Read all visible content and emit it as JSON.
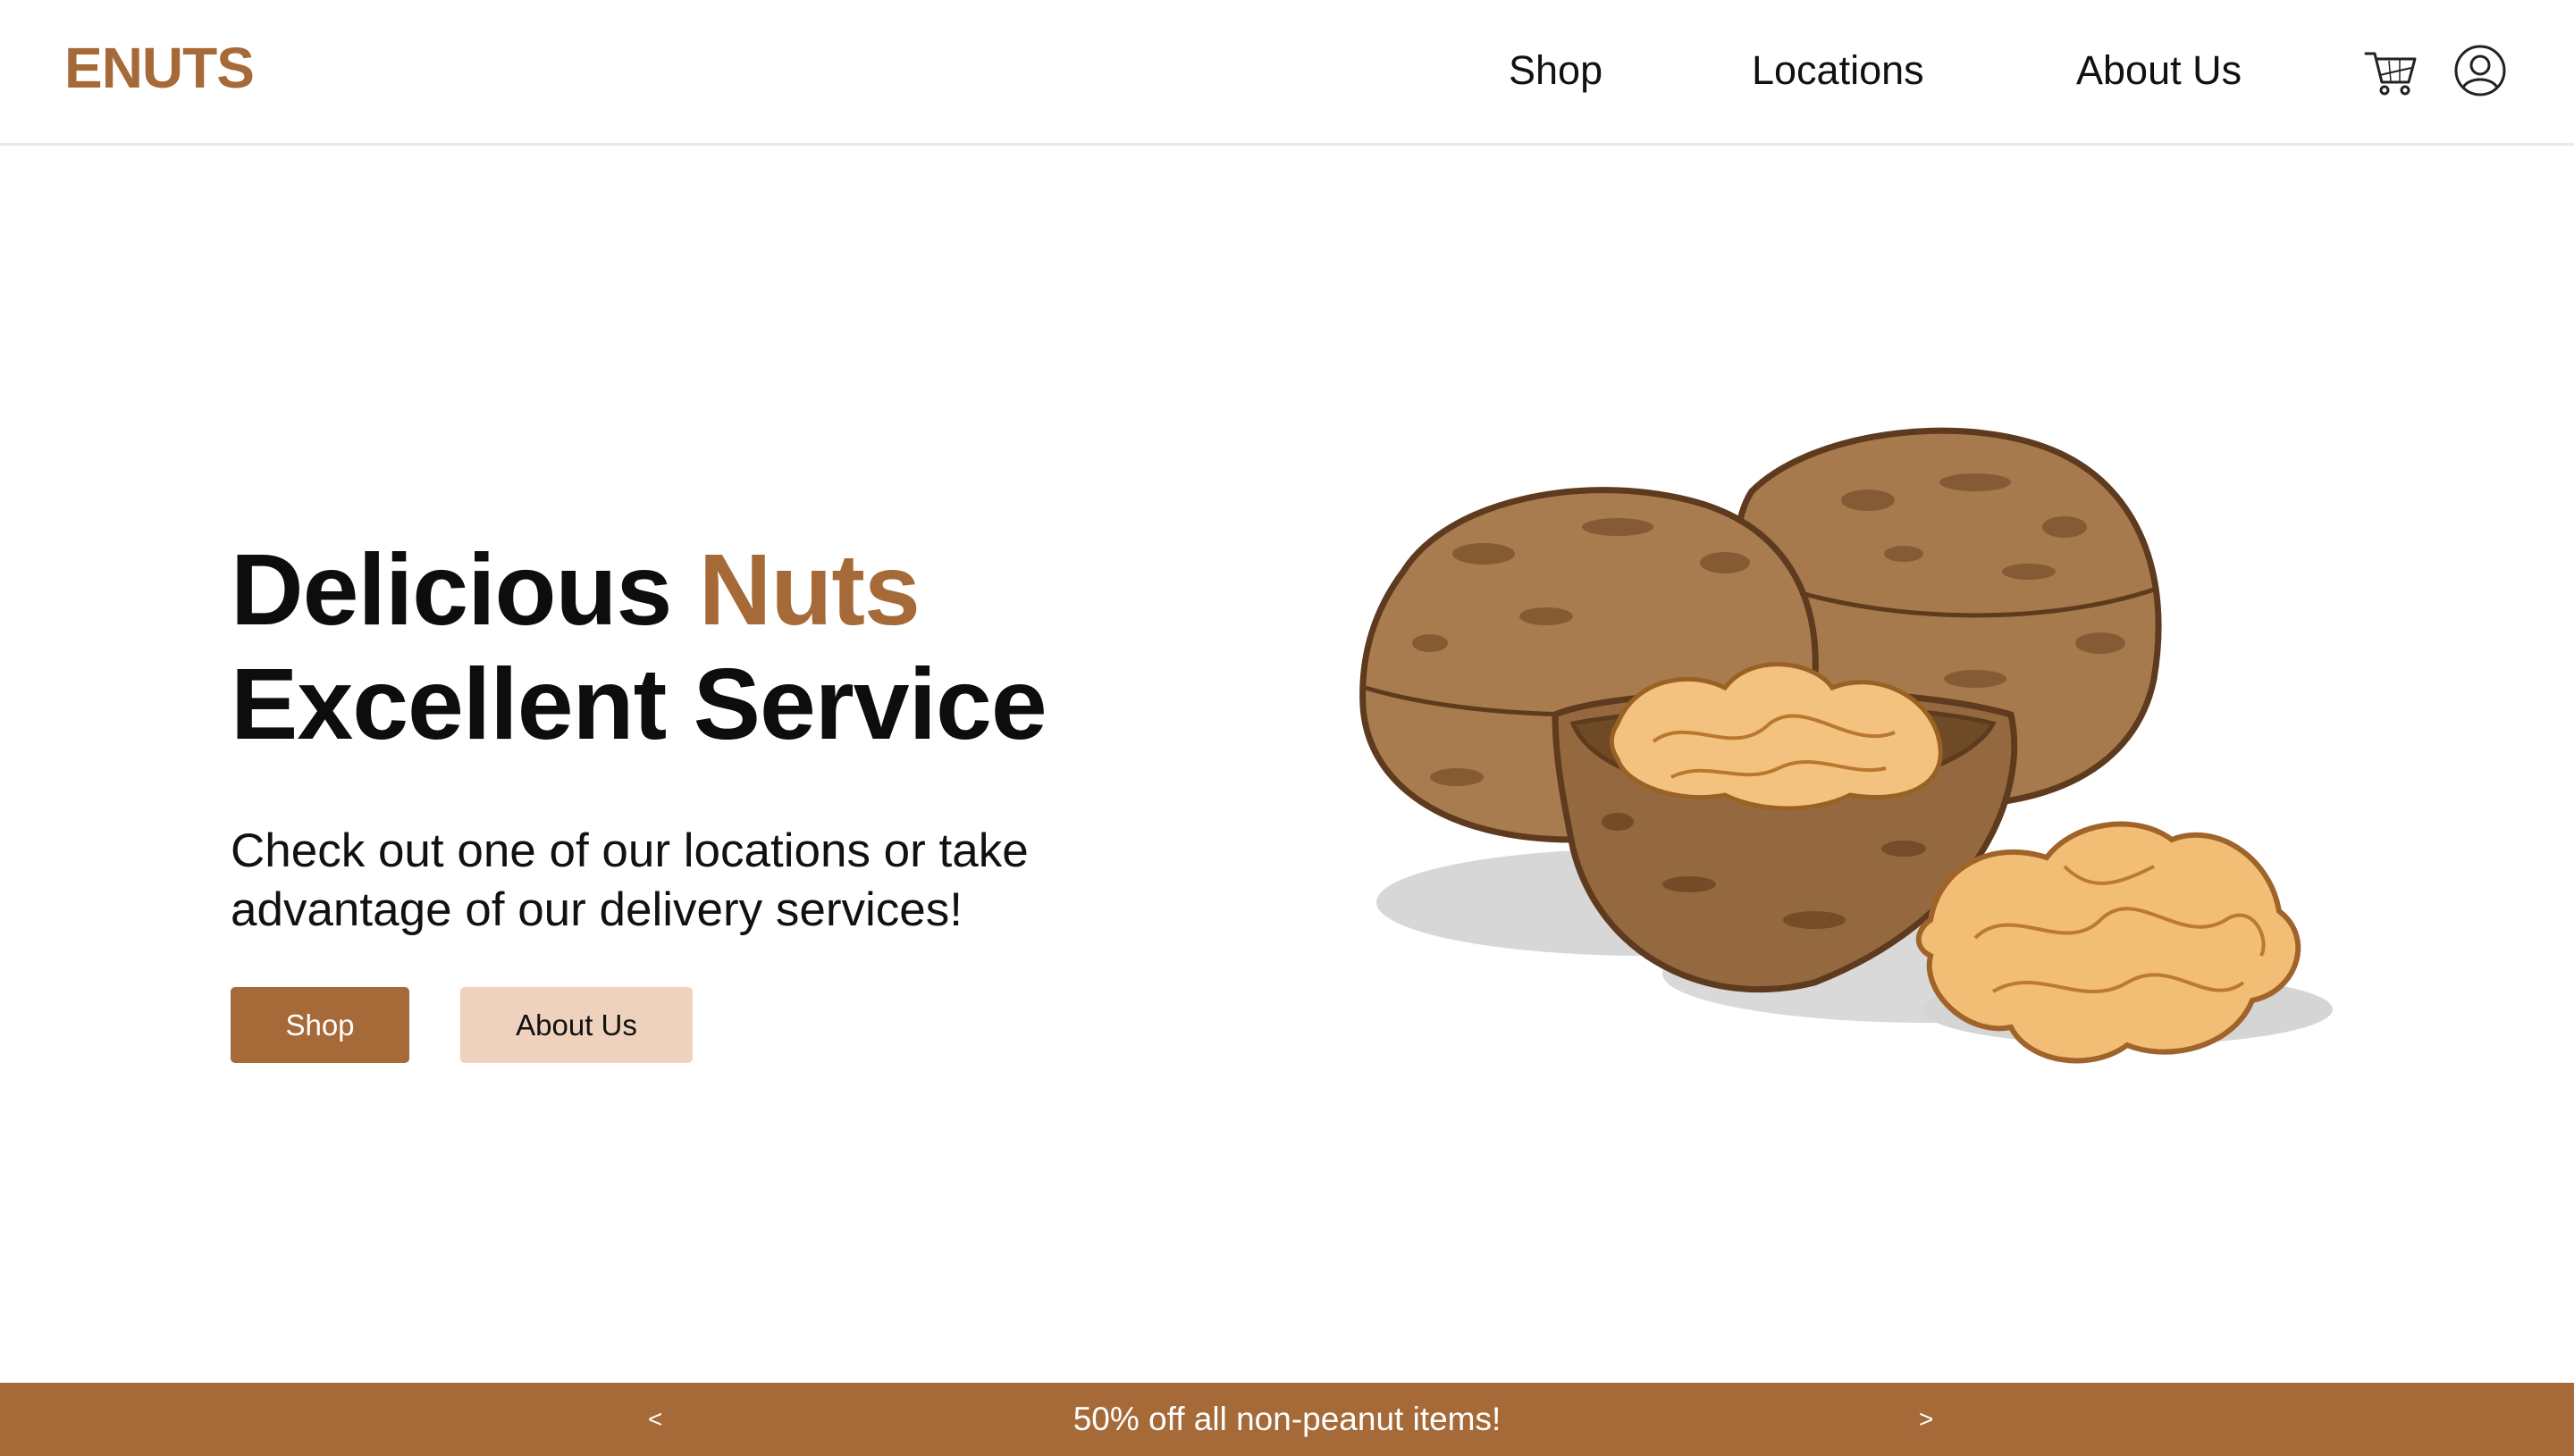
{
  "brand": {
    "logo_text": "ENUTS",
    "accent_color": "#a56a38",
    "secondary_button_color": "#efd2bd"
  },
  "nav": {
    "links": [
      {
        "label": "Shop"
      },
      {
        "label": "Locations"
      },
      {
        "label": "About Us"
      }
    ],
    "icons": [
      "cart-icon",
      "user-icon"
    ]
  },
  "hero": {
    "title_word1": "Delicious",
    "title_accent": "Nuts",
    "title_line2": "Excellent Service",
    "subtitle": "Check out one of our locations or take advantage of our delivery services!",
    "primary_button": "Shop",
    "secondary_button": "About Us",
    "image": "walnuts-illustration"
  },
  "promo": {
    "prev_label": "<",
    "text": "50% off all non-peanut items!",
    "next_label": ">"
  }
}
